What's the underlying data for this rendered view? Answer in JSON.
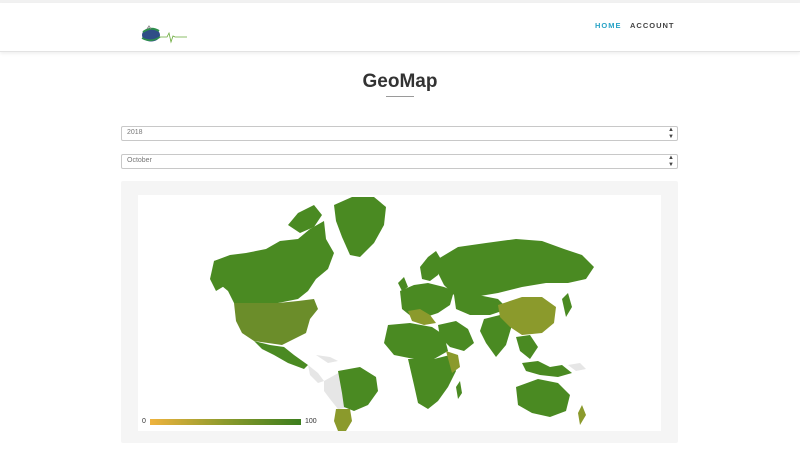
{
  "nav": {
    "home": "HOME",
    "account": "ACCOUNT"
  },
  "page": {
    "title": "GeoMap"
  },
  "filters": {
    "year": "2018",
    "month": "October"
  },
  "map": {
    "legend_min": "0",
    "legend_max": "100",
    "colors": {
      "low": "#efb33e",
      "mid": "#8b9a2c",
      "high": "#3b7d1d",
      "land": "#4a8a22",
      "land_mid": "#6b8d2a",
      "land_low": "#8b9a2c",
      "no_data": "#e6e6e6"
    }
  },
  "accent": "#29a3c6"
}
